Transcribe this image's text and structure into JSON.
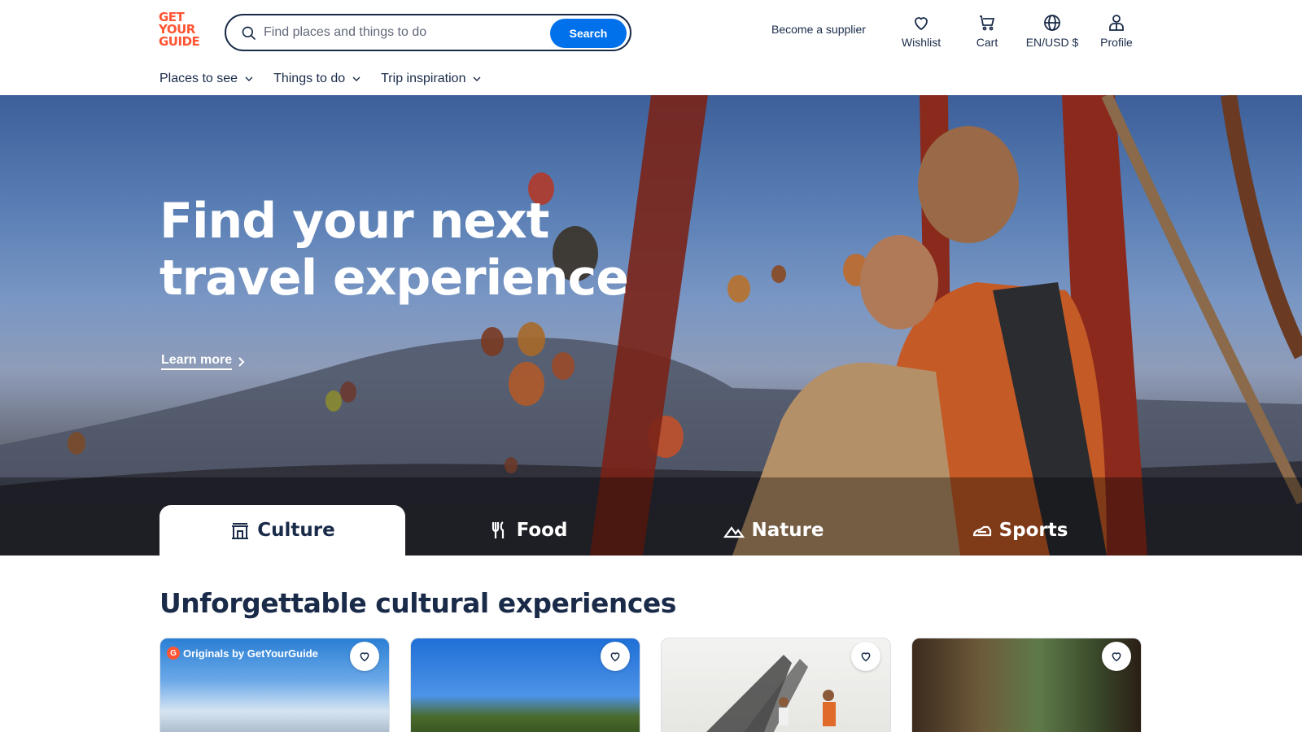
{
  "header": {
    "logo": [
      "GET",
      "YOUR",
      "GUIDE"
    ],
    "search": {
      "placeholder": "Find places and things to do",
      "button_label": "Search"
    },
    "supplier_link": "Become a supplier",
    "items": [
      {
        "label": "Wishlist",
        "icon": "heart-icon"
      },
      {
        "label": "Cart",
        "icon": "cart-icon"
      },
      {
        "label": "EN/USD $",
        "icon": "globe-icon"
      },
      {
        "label": "Profile",
        "icon": "profile-icon"
      }
    ]
  },
  "nav": [
    {
      "label": "Places to see"
    },
    {
      "label": "Things to do"
    },
    {
      "label": "Trip inspiration"
    }
  ],
  "hero": {
    "title": "Find your next travel experience",
    "learn_more": "Learn more"
  },
  "tabs": [
    {
      "label": "Culture",
      "icon": "culture-icon",
      "active": true
    },
    {
      "label": "Food",
      "icon": "food-icon",
      "active": false
    },
    {
      "label": "Nature",
      "icon": "nature-icon",
      "active": false
    },
    {
      "label": "Sports",
      "icon": "sports-icon",
      "active": false
    }
  ],
  "section": {
    "title": "Unforgettable cultural experiences",
    "cards": [
      {
        "badge": "Originals by GetYourGuide"
      },
      {
        "badge": ""
      },
      {
        "badge": ""
      },
      {
        "badge": ""
      }
    ]
  },
  "colors": {
    "brand": "#ff5533",
    "accent": "#0071eb",
    "text": "#1a2b49"
  }
}
